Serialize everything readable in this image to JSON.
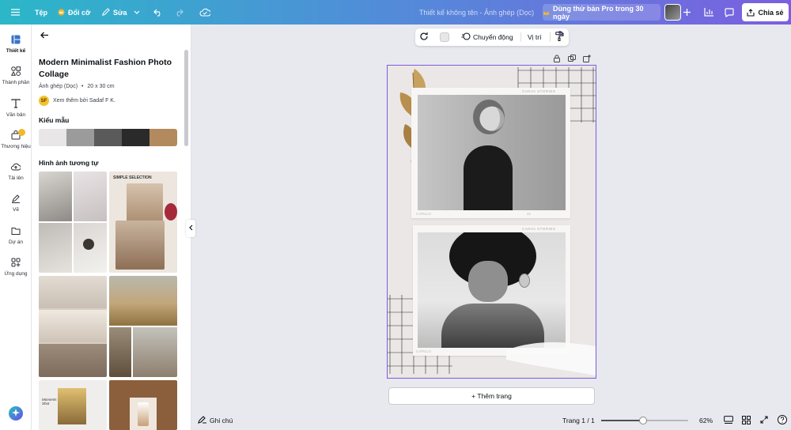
{
  "topbar": {
    "file_label": "Tệp",
    "resize_label": "Đổi cỡ",
    "edit_label": "Sửa",
    "doc_title": "Thiết kế không tên - Ảnh ghép (Dọc)",
    "pro_label": "Dùng thử bản Pro trong 30 ngày",
    "share_label": "Chia sẻ"
  },
  "rail": {
    "items": [
      {
        "label": "Thiết kế",
        "icon": "layout-icon"
      },
      {
        "label": "Thành phần",
        "icon": "shapes-icon"
      },
      {
        "label": "Văn bản",
        "icon": "text-icon"
      },
      {
        "label": "Thương hiệu",
        "icon": "brand-icon"
      },
      {
        "label": "Tải lên",
        "icon": "upload-cloud-icon"
      },
      {
        "label": "Vẽ",
        "icon": "draw-icon"
      },
      {
        "label": "Dự án",
        "icon": "folder-icon"
      },
      {
        "label": "Ứng dụng",
        "icon": "apps-icon"
      }
    ]
  },
  "panel": {
    "template_title": "Modern Minimalist Fashion Photo Collage",
    "template_type": "Ảnh ghép (Dọc)",
    "template_size": "20 x 30 cm",
    "author_initials": "SF",
    "author_label": "Xem thêm bởi Sadaf F K.",
    "styles_title": "Kiểu mẫu",
    "palette": [
      "#e8e6e6",
      "#9b9b9b",
      "#5a5a5a",
      "#2a2a2a",
      "#b38a5e"
    ],
    "similar_title": "Hình ảnh tương tự",
    "thumb_text_1": "SIMPLE SELECTION",
    "thumb_text_2": "Moments Shot"
  },
  "toolbar": {
    "animate_label": "Chuyển động",
    "position_label": "Vị trí"
  },
  "canvas": {
    "brand_text": "CANVA STORIES",
    "frame_caption_left": "CAPILLO",
    "frame_caption_right": "22",
    "add_page_label": "+ Thêm trang"
  },
  "bottombar": {
    "notes_label": "Ghi chú",
    "page_indicator": "Trang 1 / 1",
    "zoom": "62%",
    "zoom_fraction": 0.48
  }
}
